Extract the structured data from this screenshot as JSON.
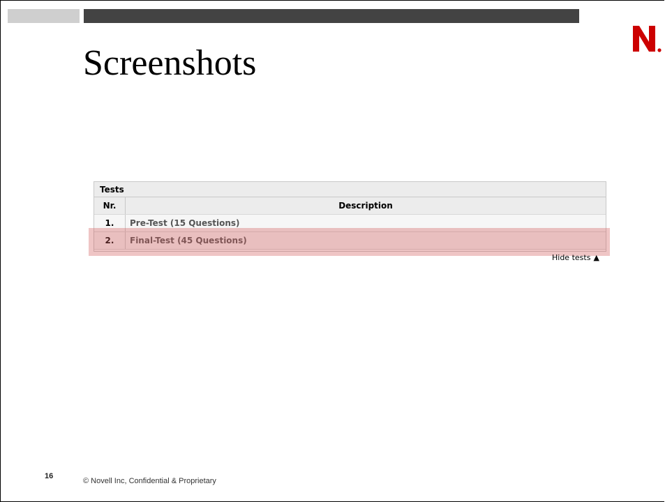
{
  "slide": {
    "title": "Screenshots",
    "page_number": "16",
    "footer": "© Novell Inc, Confidential & Proprietary",
    "logo_text": "N",
    "logo_color": "#cc0000",
    "bar_gray_color": "#cfcfcf",
    "bar_dark_color": "#434343"
  },
  "tests_panel": {
    "header": "Tests",
    "columns": {
      "nr": "Nr.",
      "description": "Description"
    },
    "rows": [
      {
        "nr": "1.",
        "description": "Pre-Test (15 Questions)"
      },
      {
        "nr": "2.",
        "description": "Final-Test (45 Questions)"
      }
    ],
    "highlighted_row": 2,
    "highlight_color": "#d25a5a",
    "toggle_label": "Hide tests",
    "toggle_arrow": "▲"
  }
}
